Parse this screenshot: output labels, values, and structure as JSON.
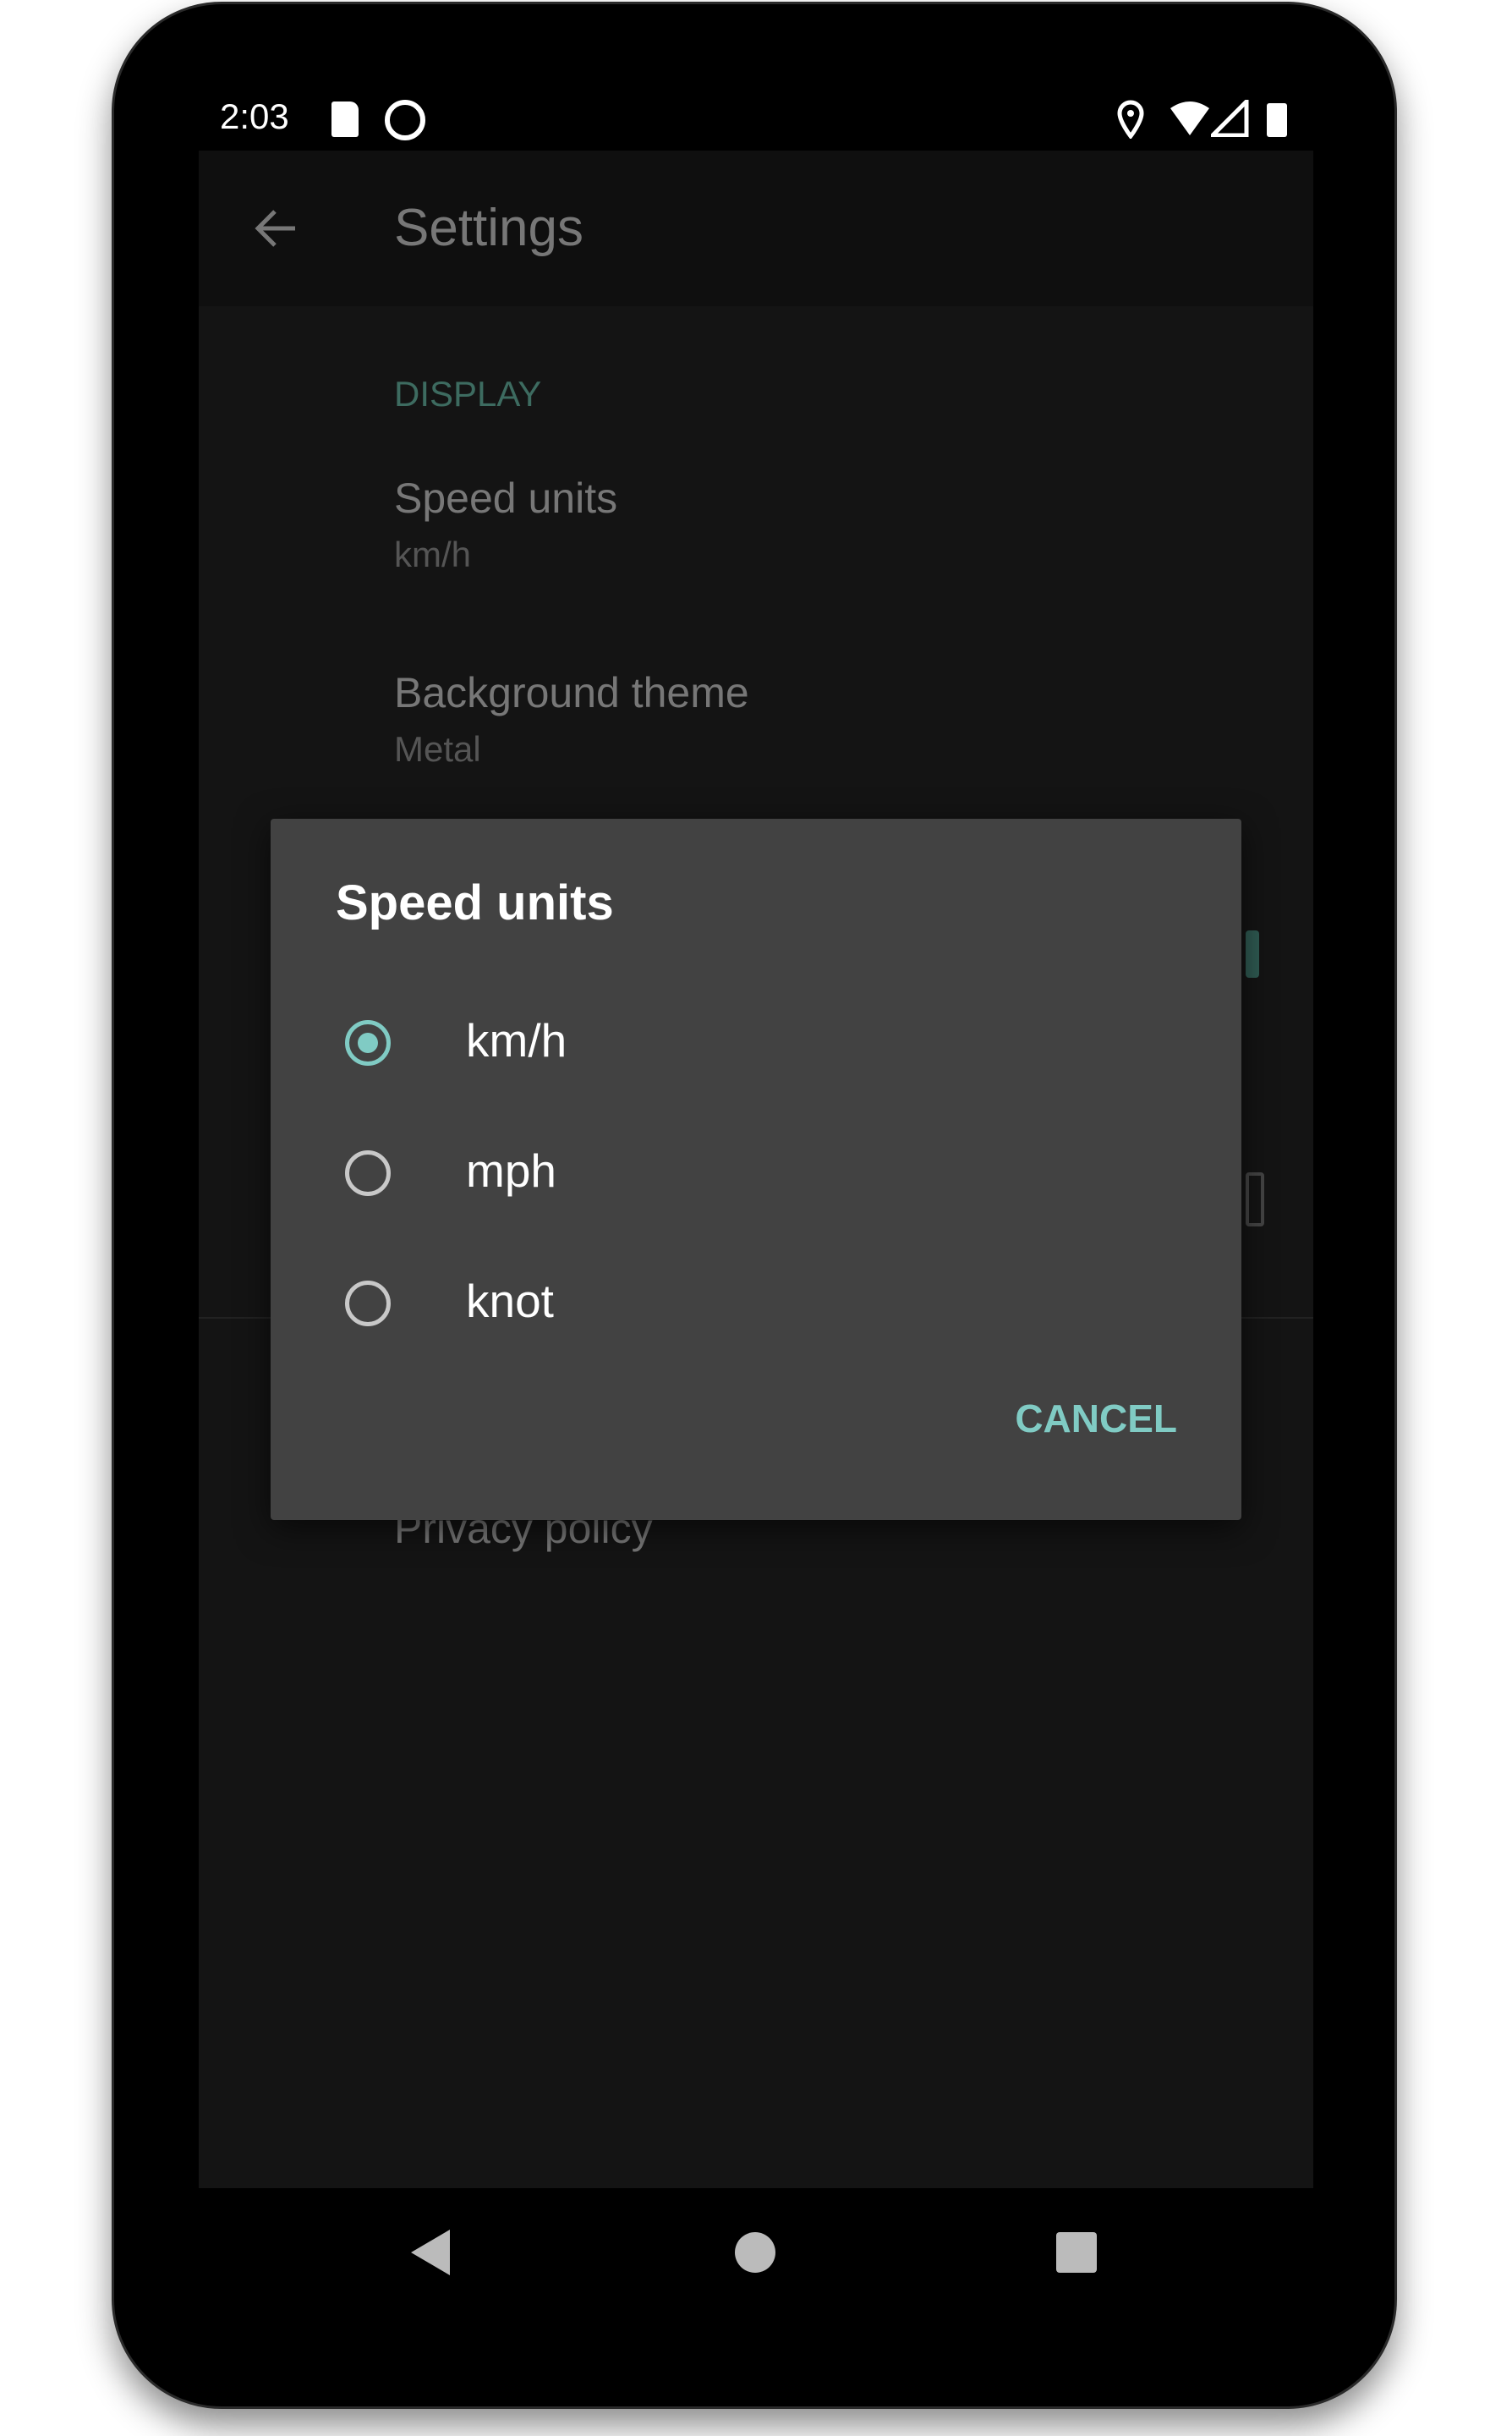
{
  "status_bar": {
    "time": "2:03",
    "icons": [
      "sd-card-icon",
      "sync-icon",
      "location-icon",
      "wifi-icon",
      "signal-icon",
      "battery-icon"
    ]
  },
  "app_bar": {
    "title": "Settings",
    "back_icon": "arrow-back-icon"
  },
  "settings": {
    "section": "DISPLAY",
    "items": [
      {
        "title": "Speed units",
        "value": "km/h"
      },
      {
        "title": "Background theme",
        "value": "Metal"
      },
      {
        "title": "Privacy policy"
      }
    ]
  },
  "dialog": {
    "title": "Speed units",
    "options": [
      {
        "label": "km/h",
        "selected": true
      },
      {
        "label": "mph",
        "selected": false
      },
      {
        "label": "knot",
        "selected": false
      }
    ],
    "cancel": "CANCEL"
  },
  "colors": {
    "accent": "#80cbc4",
    "section": "#3d6b60",
    "dialog_bg": "#424242"
  },
  "nav_bar": {
    "icons": [
      "back-icon",
      "home-icon",
      "recents-icon"
    ]
  }
}
